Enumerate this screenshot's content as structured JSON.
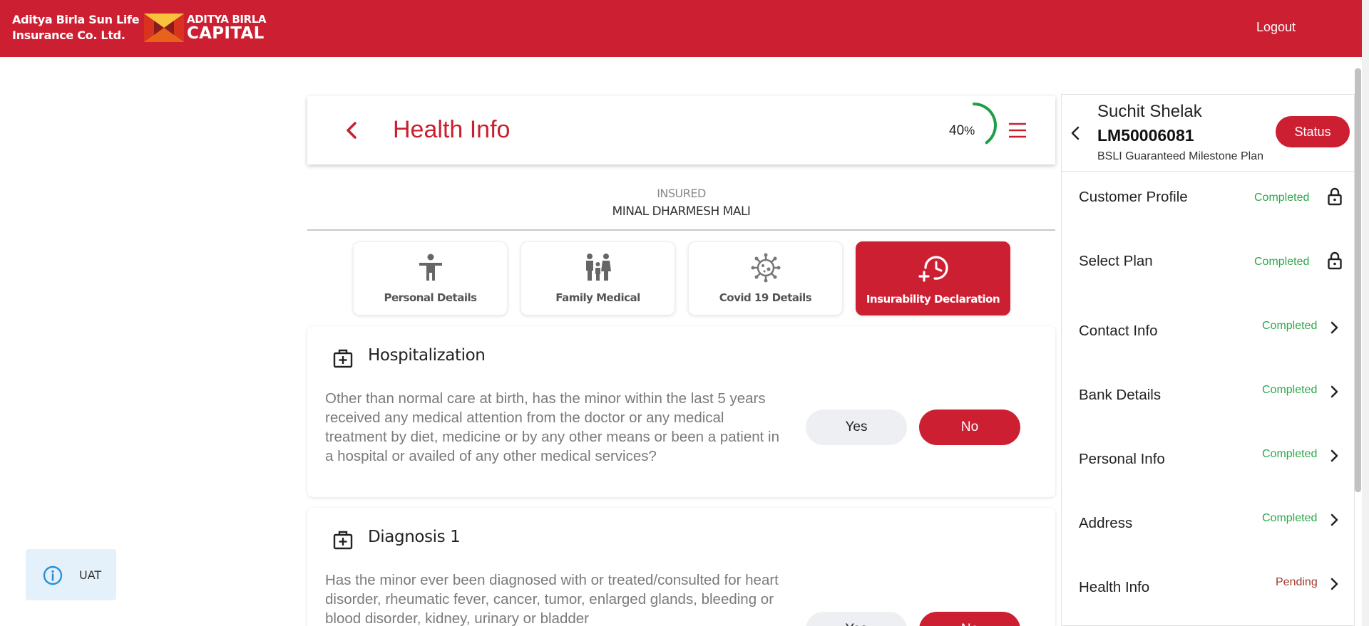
{
  "header": {
    "company_line1": "Aditya Birla Sun Life",
    "company_line2": "Insurance Co. Ltd.",
    "logo_line1": "ADITYA BIRLA",
    "logo_line2": "CAPITAL",
    "logout_label": "Logout"
  },
  "title_card": {
    "title": "Health Info",
    "progress_value": "40",
    "progress_unit": "%",
    "progress_fraction": 0.4,
    "back_icon": "chevron-left-icon",
    "menu_icon": "hamburger-icon"
  },
  "insured": {
    "label": "INSURED",
    "name": "MINAL DHARMESH MALI"
  },
  "tabs": [
    {
      "label": "Personal Details",
      "icon": "person-icon",
      "active": false
    },
    {
      "label": "Family Medical",
      "icon": "family-icon",
      "active": false
    },
    {
      "label": "Covid 19 Details",
      "icon": "virus-icon",
      "active": false
    },
    {
      "label": "Insurability Declaration",
      "icon": "clock-plus-icon",
      "active": true
    }
  ],
  "questions": [
    {
      "title": "Hospitalization",
      "text": "Other than normal care at birth, has the minor within the last 5 years received any medical attention from the doctor or any medical treatment by diet, medicine or by any other means or been a patient in a hospital or availed of any other medical services?",
      "yes_label": "Yes",
      "no_label": "No",
      "selected": "No"
    },
    {
      "title": "Diagnosis 1",
      "text": "Has the minor ever been diagnosed with or treated/consulted for heart disorder, rheumatic fever, cancer, tumor, enlarged glands, bleeding or blood disorder, kidney, urinary or bladder",
      "yes_label": "Yes",
      "no_label": "No",
      "selected": "No"
    }
  ],
  "uat_badge": {
    "label": "UAT",
    "icon": "info-icon"
  },
  "right_panel": {
    "customer_name": "Suchit Shelak",
    "application_id": "LM50006081",
    "plan_name": "BSLI Guaranteed Milestone Plan",
    "status_button": "Status",
    "steps": [
      {
        "name": "Customer Profile",
        "status": "Completed",
        "icon": "lock-icon"
      },
      {
        "name": "Select Plan",
        "status": "Completed",
        "icon": "lock-icon"
      },
      {
        "name": "Contact Info",
        "status": "Completed",
        "icon": "chevron-right-icon"
      },
      {
        "name": "Bank Details",
        "status": "Completed",
        "icon": "chevron-right-icon"
      },
      {
        "name": "Personal Info",
        "status": "Completed",
        "icon": "chevron-right-icon"
      },
      {
        "name": "Address",
        "status": "Completed",
        "icon": "chevron-right-icon"
      },
      {
        "name": "Health Info",
        "status": "Pending",
        "icon": "chevron-right-icon"
      }
    ]
  },
  "colors": {
    "brand_red": "#cd1f32",
    "progress_green": "#1e9e4a",
    "completed_green": "#2ba84a",
    "pending_red": "#a33a2e",
    "uat_bg": "#e4f1fb"
  }
}
